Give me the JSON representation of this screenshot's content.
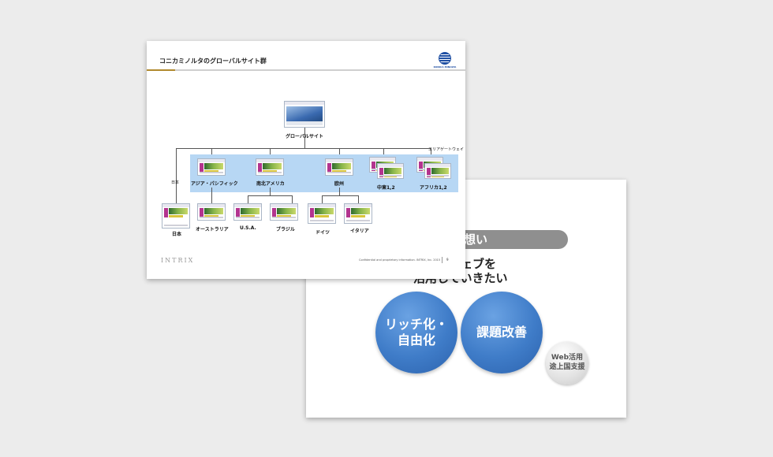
{
  "back_slide": {
    "heading_fragment": "国の想い",
    "line1": "ングにウェブを",
    "line2": "活用していきたい",
    "circle_left": "リッチ化・\n自由化",
    "circle_right": "課題改善",
    "circle_small": "Web活用\n途上国支援",
    "colors": {
      "circle": "#3f7cc8",
      "pill": "#8f8f8f"
    }
  },
  "front_slide": {
    "title": "コニカミノルタのグローバルサイト群",
    "logo_text": "KONICA MINOLTA",
    "top_label": "グローバルサイト",
    "area_gateway": "エリアゲートウェイ",
    "japan_side": "日本",
    "regions": [
      "アジア・パシフィック",
      "南北アメリカ",
      "欧州",
      "中東1,2",
      "アフリカ1,2"
    ],
    "countries": [
      "日本",
      "オーストラリア",
      "U.S.A.",
      "ブラジル",
      "ドイツ",
      "イタリア"
    ],
    "footer_brand": "INTRIX",
    "confidential": "Confidential and proprietary information. INTRIX, Inc. 2015",
    "page_number": "9",
    "colors": {
      "band": "#b7d7f4",
      "gold_rule": "#b08a2e"
    }
  }
}
